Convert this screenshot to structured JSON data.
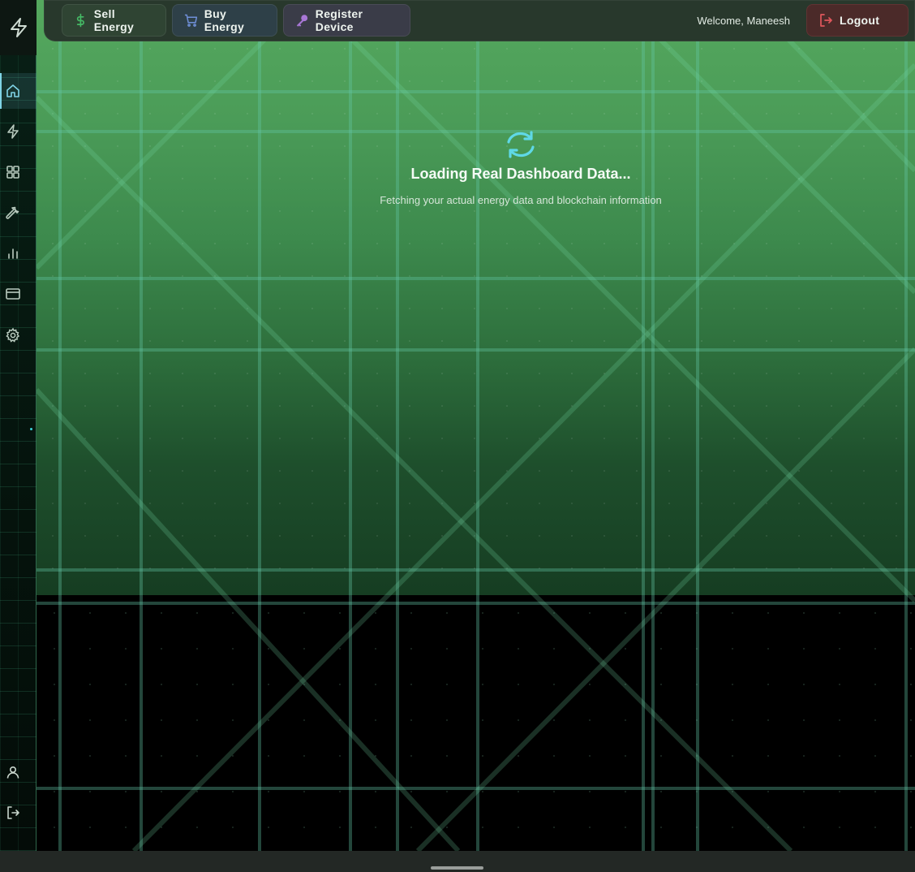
{
  "sidebar": {
    "logo_icon": "lightning-bolt-icon",
    "items": [
      {
        "name": "home",
        "icon": "home-icon",
        "active": true
      },
      {
        "name": "energy",
        "icon": "lightning-icon",
        "active": false
      },
      {
        "name": "dashboard",
        "icon": "grid-icon",
        "active": false
      },
      {
        "name": "devices",
        "icon": "wrench-icon",
        "active": false
      },
      {
        "name": "analytics",
        "icon": "bar-chart-icon",
        "active": false
      },
      {
        "name": "payments",
        "icon": "credit-card-icon",
        "active": false
      },
      {
        "name": "settings",
        "icon": "gear-icon",
        "active": false
      }
    ],
    "bottom_items": [
      {
        "name": "profile",
        "icon": "user-icon"
      },
      {
        "name": "sign-out",
        "icon": "logout-icon"
      }
    ]
  },
  "header": {
    "sell_label": "Sell Energy",
    "buy_label": "Buy Energy",
    "register_label": "Register Device",
    "welcome_text": "Welcome, Maneesh",
    "logout_label": "Logout"
  },
  "loading": {
    "title": "Loading Real Dashboard Data...",
    "subtitle": "Fetching your actual energy data and blockchain information"
  },
  "colors": {
    "accent": "#5fd8e6",
    "sell_icon": "#45b865",
    "buy_icon": "#6f8fd8",
    "register_icon": "#a877d6",
    "logout_icon": "#e0575c"
  }
}
